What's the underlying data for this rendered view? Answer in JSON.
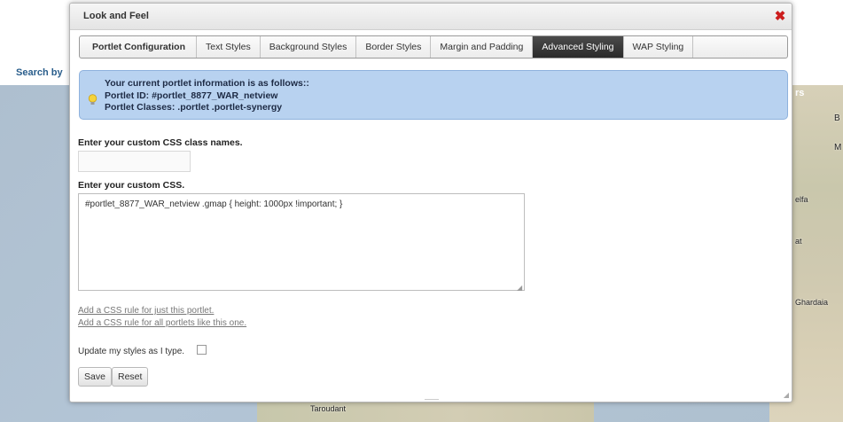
{
  "background": {
    "search_link": "Search by",
    "map_labels": {
      "tr_label": "rs",
      "b_label": "B",
      "m_label": "M",
      "elfa_label": "elfa",
      "at_label": "at",
      "ghardaia_label": "Ghardaia",
      "taroudant_label": "Taroudant"
    }
  },
  "dialog": {
    "title": "Look and Feel",
    "tabs": [
      {
        "label": "Portlet Configuration"
      },
      {
        "label": "Text Styles"
      },
      {
        "label": "Background Styles"
      },
      {
        "label": "Border Styles"
      },
      {
        "label": "Margin and Padding"
      },
      {
        "label": "Advanced Styling"
      },
      {
        "label": "WAP Styling"
      }
    ],
    "active_tab": "Advanced Styling",
    "info": {
      "line1": "Your current portlet information is as follows::",
      "line2": "Portlet ID: #portlet_8877_WAR_netview",
      "line3": "Portlet Classes: .portlet .portlet-synergy"
    },
    "css_class_label": "Enter your custom CSS class names.",
    "css_class_value": "",
    "custom_css_label": "Enter your custom CSS.",
    "custom_css_value": "#portlet_8877_WAR_netview .gmap { height: 1000px !important; }",
    "link_this_portlet": "Add a CSS rule for just this portlet.",
    "link_all_portlets": "Add a CSS rule for all portlets like this one.",
    "update_styles_label": "Update my styles as I type.",
    "update_styles_checked": false,
    "save_label": "Save",
    "reset_label": "Reset"
  },
  "colors": {
    "active_tab_bg": "#333333",
    "info_bg": "#b8d2f0",
    "close_icon": "#cc1d1d"
  }
}
